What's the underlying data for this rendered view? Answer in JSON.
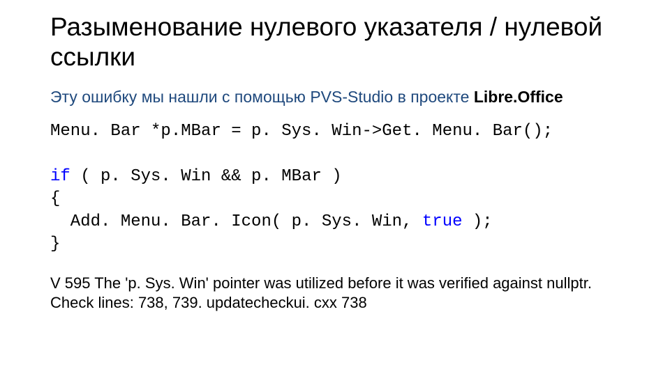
{
  "title": "Разыменование нулевого указателя / нулевой ссылки",
  "subtitle_prefix": "Эту ошибку мы нашли с помощью PVS-Studio в проекте ",
  "subtitle_bold": "Libre.Office",
  "code": {
    "line1": "Menu. Bar *p.MBar = p. Sys. Win->Get. Menu. Bar();",
    "kw_if": "if",
    "line2_rest": " ( p. Sys. Win && p. MBar )",
    "line3": "{",
    "line4_indent": "  Add. Menu. Bar. Icon( p. Sys. Win, ",
    "kw_true": "true",
    "line4_tail": " );",
    "line5": "}"
  },
  "footnote": "V 595 The 'p. Sys. Win' pointer was utilized before it was verified against nullptr. Check lines: 738, 739. updatecheckui. cxx 738"
}
